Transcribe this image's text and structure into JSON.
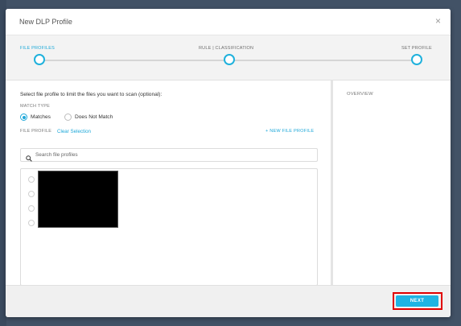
{
  "dialog": {
    "title": "New DLP Profile",
    "close_glyph": "×"
  },
  "stepper": {
    "steps": [
      {
        "label": "FILE PROFILES",
        "active": true
      },
      {
        "label": "RULE | CLASSIFICATION",
        "active": false
      },
      {
        "label": "SET PROFILE",
        "active": false
      }
    ],
    "accent_color": "#1fb1dc"
  },
  "main": {
    "instruction": "Select file profile to limit the files you want to scan (optional):",
    "match_type_label": "MATCH TYPE",
    "match_options": [
      {
        "label": "Matches",
        "selected": true
      },
      {
        "label": "Does Not Match",
        "selected": false
      }
    ],
    "file_profile_label": "FILE PROFILE",
    "clear_selection": "Clear Selection",
    "new_file_profile": "+ NEW FILE PROFILE",
    "search": {
      "placeholder": "Search file profiles",
      "value": ""
    },
    "list_item_count_visible": 4
  },
  "overview": {
    "label": "OVERVIEW"
  },
  "footer": {
    "next_label": "NEXT",
    "highlight_color": "#e00000"
  }
}
